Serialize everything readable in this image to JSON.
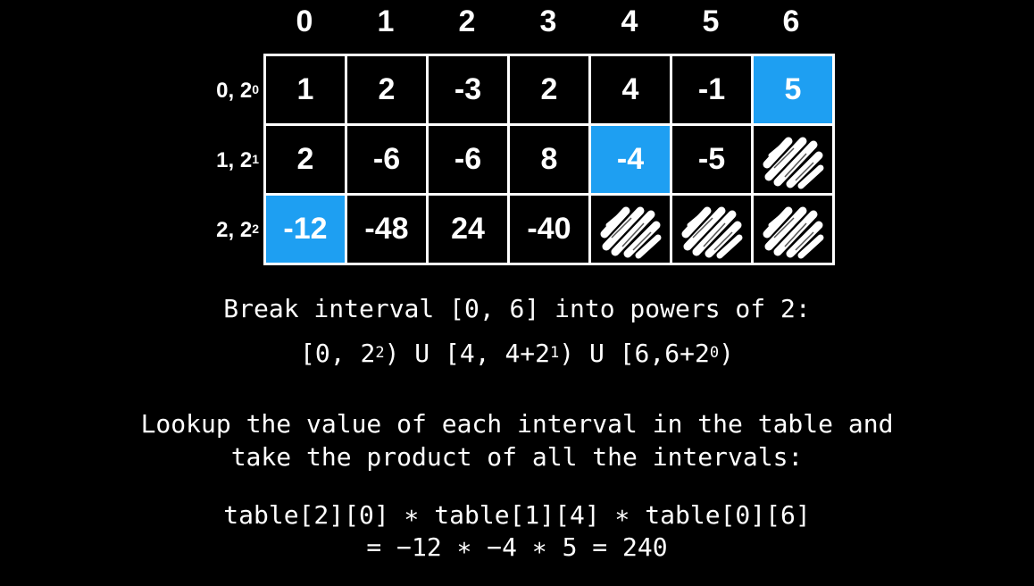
{
  "table": {
    "column_headers": [
      "0",
      "1",
      "2",
      "3",
      "4",
      "5",
      "6"
    ],
    "row_labels": [
      {
        "base": "0, 2",
        "exp": "0"
      },
      {
        "base": "1, 2",
        "exp": "1"
      },
      {
        "base": "2, 2",
        "exp": "2"
      }
    ],
    "rows": [
      [
        "1",
        "2",
        "-3",
        "2",
        "4",
        "-1",
        "5"
      ],
      [
        "2",
        "-6",
        "-6",
        "8",
        "-4",
        "-5",
        ""
      ],
      [
        "-12",
        "-48",
        "24",
        "-40",
        "",
        "",
        ""
      ]
    ],
    "highlighted_cells": [
      [
        0,
        6
      ],
      [
        1,
        4
      ],
      [
        2,
        0
      ]
    ],
    "scribbled_cells": [
      [
        1,
        6
      ],
      [
        2,
        4
      ],
      [
        2,
        5
      ],
      [
        2,
        6
      ]
    ],
    "highlight_color": "#1e9ff2"
  },
  "explanation": {
    "line1": "Break interval [0, 6] into powers of 2:",
    "line2": {
      "p1": "[0, 2",
      "e1": "2",
      "p2": ") U [4, 4+2",
      "e2": "1",
      "p3": ") U [6,6+2",
      "e3": "0",
      "p4": ")"
    },
    "line3": "Lookup the value of each interval in the table and",
    "line4": "take the product of all the intervals:",
    "line5": "table[2][0] ∗ table[1][4] ∗ table[0][6]",
    "line6": "= −12 ∗ −4 ∗ 5 = 240"
  }
}
